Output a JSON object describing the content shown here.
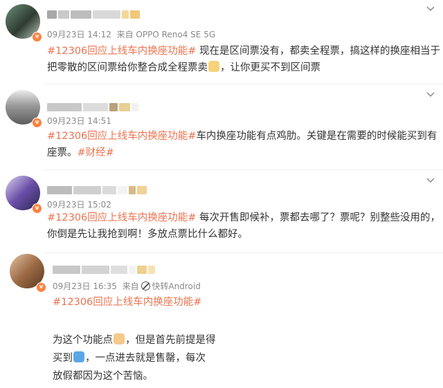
{
  "posts": [
    {
      "time": "09月23日 14:12",
      "from_prefix": "来自",
      "device": "OPPO Reno4 SE 5G",
      "topic": "#12306回应上线车内换座功能#",
      "text_a": " 现在是区间票没有，都卖全程票，搞这样的换座相当于",
      "text_b": "把零散的区间票给你整合成全程票卖",
      "text_c": "，让你更买不到区间票"
    },
    {
      "time": "09月23日 14:51",
      "topic": "#12306回应上线车内换座功能#",
      "text_a": "车内换座功能有点鸡肋。关键是在需要的时候能买到有",
      "text_b": "座票。",
      "topic2": "#财经#"
    },
    {
      "time": "09月23日 15:02",
      "topic": "#12306回应上线车内换座功能#",
      "text_a": " 每次开售即候补，票都去哪了？票呢？别整些没用的，",
      "text_b": "你倒是先让我抢到啊！多放点票比什么都好。"
    },
    {
      "time": "09月23日 16:35",
      "from_prefix": "来自",
      "device": "快转Android",
      "topic": "#12306回应上线车内换座功能#",
      "line1": "为这个功能点",
      "line1b": "，但是首先前提是得",
      "line2a": "买到",
      "line2b": "，一点进去就是售罄，每次",
      "line3": "放假都因为这个苦恼。"
    }
  ],
  "colors": {
    "topic": "#eb7350",
    "meta": "#8a8a8a",
    "badge": "#ff8140"
  },
  "icons": [
    "chevron-down-icon",
    "verified-badge-icon",
    "no-entry-icon",
    "emoji-face-icon",
    "emoji-thumbs-up-icon",
    "emoji-ticket-icon"
  ]
}
